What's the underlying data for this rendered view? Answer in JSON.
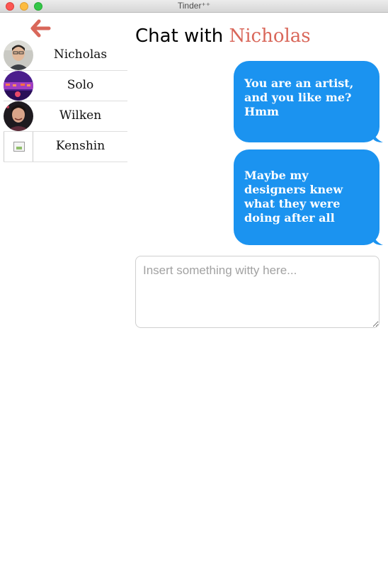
{
  "window": {
    "title": "Tinder⁺⁺"
  },
  "colors": {
    "accent": "#d9675a",
    "bubble": "#1b93f0"
  },
  "back_icon": "arrow-left-icon",
  "contacts": [
    {
      "name": "Nicholas",
      "avatar": "photo"
    },
    {
      "name": "Solo",
      "avatar": "photo"
    },
    {
      "name": "Wilken",
      "avatar": "photo"
    },
    {
      "name": "Kenshin",
      "avatar": "broken-image"
    }
  ],
  "chat": {
    "title_prefix": "Chat with",
    "partner": "Nicholas",
    "messages": [
      {
        "text": "You are an artist, and you like me? Hmm"
      },
      {
        "text": "Maybe my designers knew what they were doing after all"
      }
    ],
    "input_placeholder": "Insert something witty here..."
  }
}
